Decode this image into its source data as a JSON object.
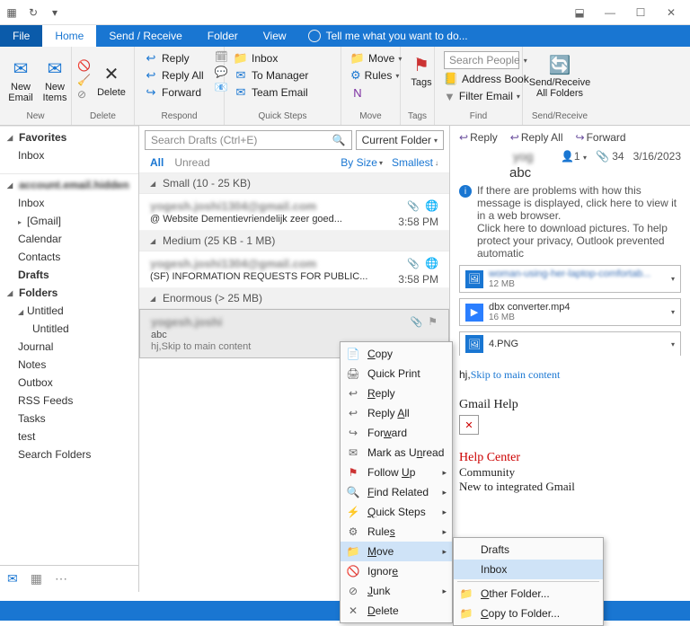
{
  "tabs": {
    "file": "File",
    "home": "Home",
    "sendreceive": "Send / Receive",
    "folder": "Folder",
    "view": "View",
    "tell": "Tell me what you want to do..."
  },
  "ribbon": {
    "new": {
      "newEmail": "New\nEmail",
      "newItems": "New\nItems",
      "label": "New"
    },
    "delete": {
      "delete": "Delete",
      "label": "Delete"
    },
    "respond": {
      "reply": "Reply",
      "replyAll": "Reply All",
      "forward": "Forward",
      "label": "Respond"
    },
    "quick": {
      "inbox": "Inbox",
      "toManager": "To Manager",
      "teamEmail": "Team Email",
      "label": "Quick Steps"
    },
    "move": {
      "move": "Move",
      "rules": "Rules",
      "label": "Move"
    },
    "tags": {
      "tags": "Tags",
      "label": "Tags"
    },
    "find": {
      "search": "Search People",
      "address": "Address Book",
      "filter": "Filter Email",
      "label": "Find"
    },
    "sr": {
      "btn": "Send/Receive\nAll Folders",
      "label": "Send/Receive"
    }
  },
  "nav": {
    "favorites": "Favorites",
    "inbox": "Inbox",
    "account": "account.email.hidden",
    "items": [
      "Inbox",
      "[Gmail]",
      "Calendar",
      "Contacts",
      "Drafts"
    ],
    "folders": "Folders",
    "untitled": "Untitled",
    "untitled2": "Untitled",
    "rest": [
      "Journal",
      "Notes",
      "Outbox",
      "RSS Feeds",
      "Tasks",
      "test",
      "Search Folders"
    ]
  },
  "list": {
    "searchPlaceholder": "Search Drafts (Ctrl+E)",
    "scope": "Current Folder",
    "all": "All",
    "unread": "Unread",
    "bySize": "By Size",
    "smallest": "Smallest",
    "g1": "Small (10 - 25 KB)",
    "m1_from": "yogesh.joshi1304@gmail.com",
    "m1_subj": "@ Website Dementievriendelijk zeer goed...",
    "m1_time": "3:58 PM",
    "g2": "Medium (25 KB - 1 MB)",
    "m2_from": "yogesh.joshi1304@gmail.com",
    "m2_subj": "(SF) INFORMATION REQUESTS FOR PUBLIC...",
    "m2_time": "3:58 PM",
    "g3": "Enormous (> 25 MB)",
    "m3_from": "yogesh.joshi",
    "m3_subj": "abc",
    "m3_prev": "hj,Skip to main content"
  },
  "read": {
    "reply": "Reply",
    "replyAll": "Reply All",
    "forward": "Forward",
    "sender": "yog",
    "to": "1",
    "attCount": "34",
    "date": "3/16/2023",
    "subj": "abc",
    "info1": "If there are problems with how this message is displayed, click here to view it in a web browser.",
    "info2": "Click here to download pictures. To help protect your privacy, Outlook prevented automatic",
    "a1_name": "woman-using-her-laptop-comfortab...",
    "a1_size": "12 MB",
    "a2_name": "dbx converter.mp4",
    "a2_size": "16 MB",
    "a3_name": "4.PNG",
    "body_hj": "hj,",
    "body_link": "Skip to main content",
    "gh": "Gmail Help",
    "hc": "Help Center",
    "comm": "Community",
    "ngm": "New to integrated Gmail"
  },
  "ctx": {
    "copy": "Copy",
    "quickPrint": "Quick Print",
    "reply": "Reply",
    "replyAll": "Reply All",
    "forward": "Forward",
    "markUnread": "Mark as Unread",
    "followUp": "Follow Up",
    "findRelated": "Find Related",
    "quickSteps": "Quick Steps",
    "rules": "Rules",
    "move": "Move",
    "ignore": "Ignore",
    "junk": "Junk",
    "delete": "Delete"
  },
  "sub": {
    "drafts": "Drafts",
    "inbox": "Inbox",
    "other": "Other Folder...",
    "copyTo": "Copy to Folder..."
  }
}
